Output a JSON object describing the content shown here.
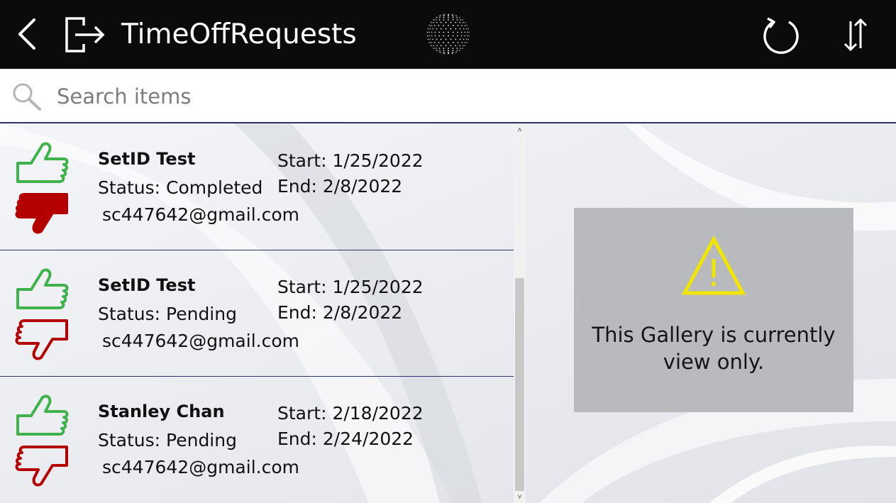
{
  "header": {
    "title": "TimeOffRequests",
    "icons": [
      "back-arrow-icon",
      "exit-icon",
      "globe-icon",
      "refresh-icon",
      "sort-icon"
    ]
  },
  "search": {
    "placeholder": "Search items",
    "value": ""
  },
  "gallery": {
    "items": [
      {
        "name": "SetID Test",
        "status": "Status: Completed",
        "email": "sc447642@gmail.com",
        "start": "Start: 1/25/2022",
        "end": "End: 2/8/2022",
        "thumb_down_filled": true
      },
      {
        "name": "SetID Test",
        "status": "Status: Pending",
        "email": "sc447642@gmail.com",
        "start": "Start: 1/25/2022",
        "end": "End: 2/8/2022",
        "thumb_down_filled": false
      },
      {
        "name": "Stanley Chan",
        "status": "Status: Pending",
        "email": "sc447642@gmail.com",
        "start": "Start: 2/18/2022",
        "end": "End: 2/24/2022",
        "thumb_down_filled": false
      }
    ]
  },
  "notice": {
    "text": "This Gallery is currently view only.",
    "icon": "warning-icon"
  },
  "colors": {
    "header_bg": "#0b0b0b",
    "approve_green": "#3fb24b",
    "reject_red": "#b50000",
    "divider_navy": "#2b3468",
    "notice_bg": "#b9babe",
    "warning_yellow": "#f2e600"
  }
}
